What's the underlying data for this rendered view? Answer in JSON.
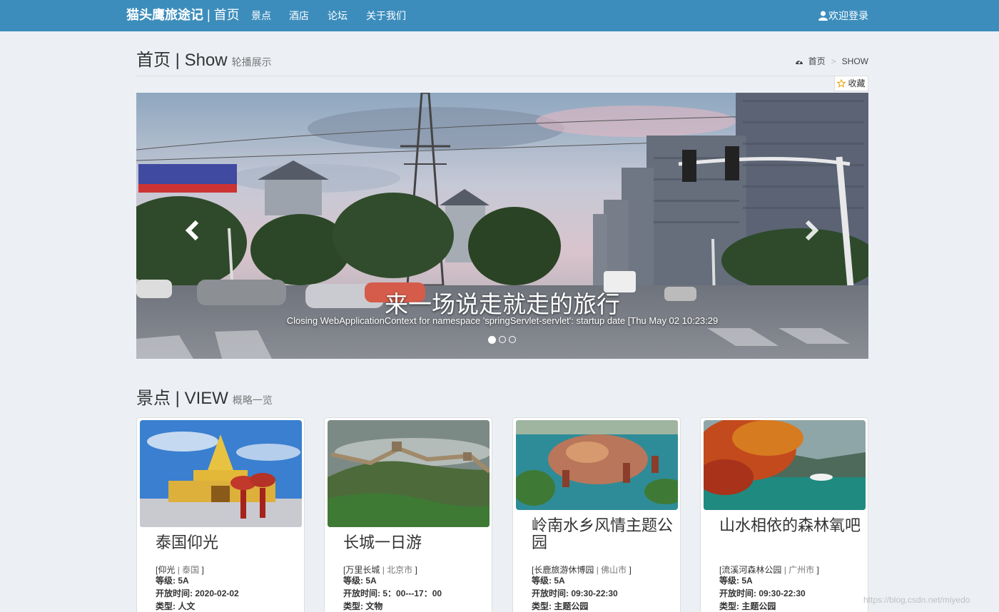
{
  "navbar": {
    "brand_bold": "猫头鹰旅途记",
    "brand_rest": " | 首页",
    "links": [
      "景点",
      "酒店",
      "论坛",
      "关于我们"
    ],
    "user": "欢迎登录"
  },
  "page_header": {
    "title": "首页 | Show",
    "subtitle": "轮播展示",
    "breadcrumb": [
      "首页",
      "SHOW"
    ]
  },
  "favorite": "收藏",
  "carousel": {
    "caption_title": "来一场说走就走的旅行",
    "caption_text": "Closing WebApplicationContext for namespace 'springServlet-servlet': startup date [Thu May 02 10:23:29",
    "indicator_count": 3,
    "active_index": 0
  },
  "section": {
    "title": "景点 | VIEW",
    "subtitle": "概略一览"
  },
  "cards": [
    {
      "title": "泰国仰光",
      "loc_name": "仰光",
      "loc_city": "泰国",
      "grade": "等级: 5A",
      "hours": "开放时间: 2020-02-02",
      "type": "类型: 人文"
    },
    {
      "title": "长城一日游",
      "loc_name": "万里长城",
      "loc_city": "北京市",
      "grade": "等级: 5A",
      "hours": "开放时间: 5：00---17：00",
      "type": "类型: 文物"
    },
    {
      "title": "岭南水乡风情主题公园",
      "loc_name": "长鹿旅游休博园",
      "loc_city": "佛山市",
      "grade": "等级: 5A",
      "hours": "开放时间: 09:30-22:30",
      "type": "类型: 主题公园"
    },
    {
      "title": "山水相依的森林氧吧",
      "loc_name": "流溪河森林公园",
      "loc_city": "广州市",
      "grade": "等级: 5A",
      "hours": "开放时间: 09:30-22:30",
      "type": "类型: 主题公园"
    }
  ],
  "watermark": "https://blog.csdn.net/miyedo",
  "colors": {
    "navbar": "#3c8dbc",
    "background": "#ecf0f5"
  }
}
